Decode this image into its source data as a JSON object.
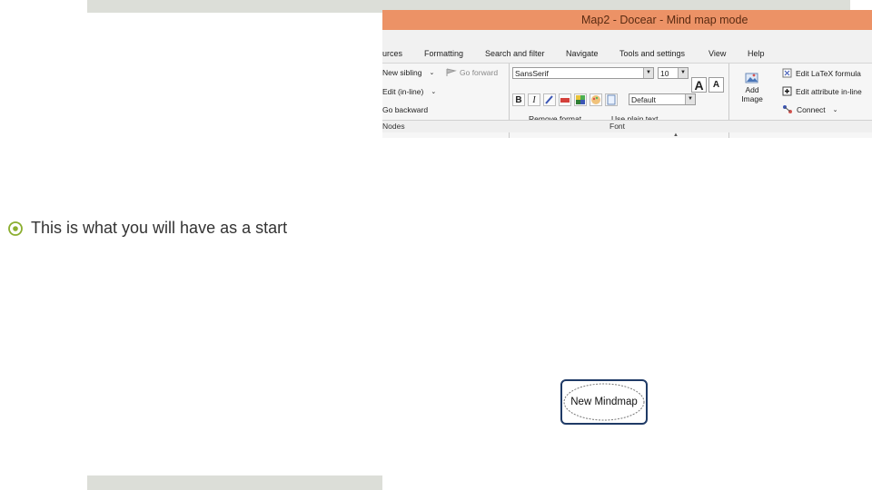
{
  "slide": {
    "bullet_text": "This is what you will have as a start",
    "bullet_icon": "circle-target-icon",
    "accent_color": "#8bae2f"
  },
  "app": {
    "title": "Map2 - Docear - Mind map mode",
    "menu": [
      "urces",
      "Formatting",
      "Search and filter",
      "Navigate",
      "Tools and settings",
      "View",
      "Help"
    ],
    "nodes_group": {
      "new_sibling": "New sibling",
      "go_forward": "Go forward",
      "edit_inline": "Edit (in-line)",
      "go_backward": "Go backward",
      "label": "Nodes"
    },
    "font_group": {
      "font_name": "SansSerif",
      "font_size": "10",
      "style": "Default",
      "remove_format": "Remove format",
      "use_plain_text": "Use plain text",
      "label": "Font",
      "bold": "B",
      "italic": "I",
      "grow": "A",
      "shrink": "A"
    },
    "insert_group": {
      "add_image_line1": "Add",
      "add_image_line2": "Image",
      "edit_latex": "Edit LaTeX formula",
      "edit_attribute": "Edit attribute in-line",
      "connect": "Connect"
    },
    "title_color": "#ec9266"
  },
  "mindmap": {
    "root_label": "New Mindmap",
    "border_color": "#1f3a66"
  }
}
